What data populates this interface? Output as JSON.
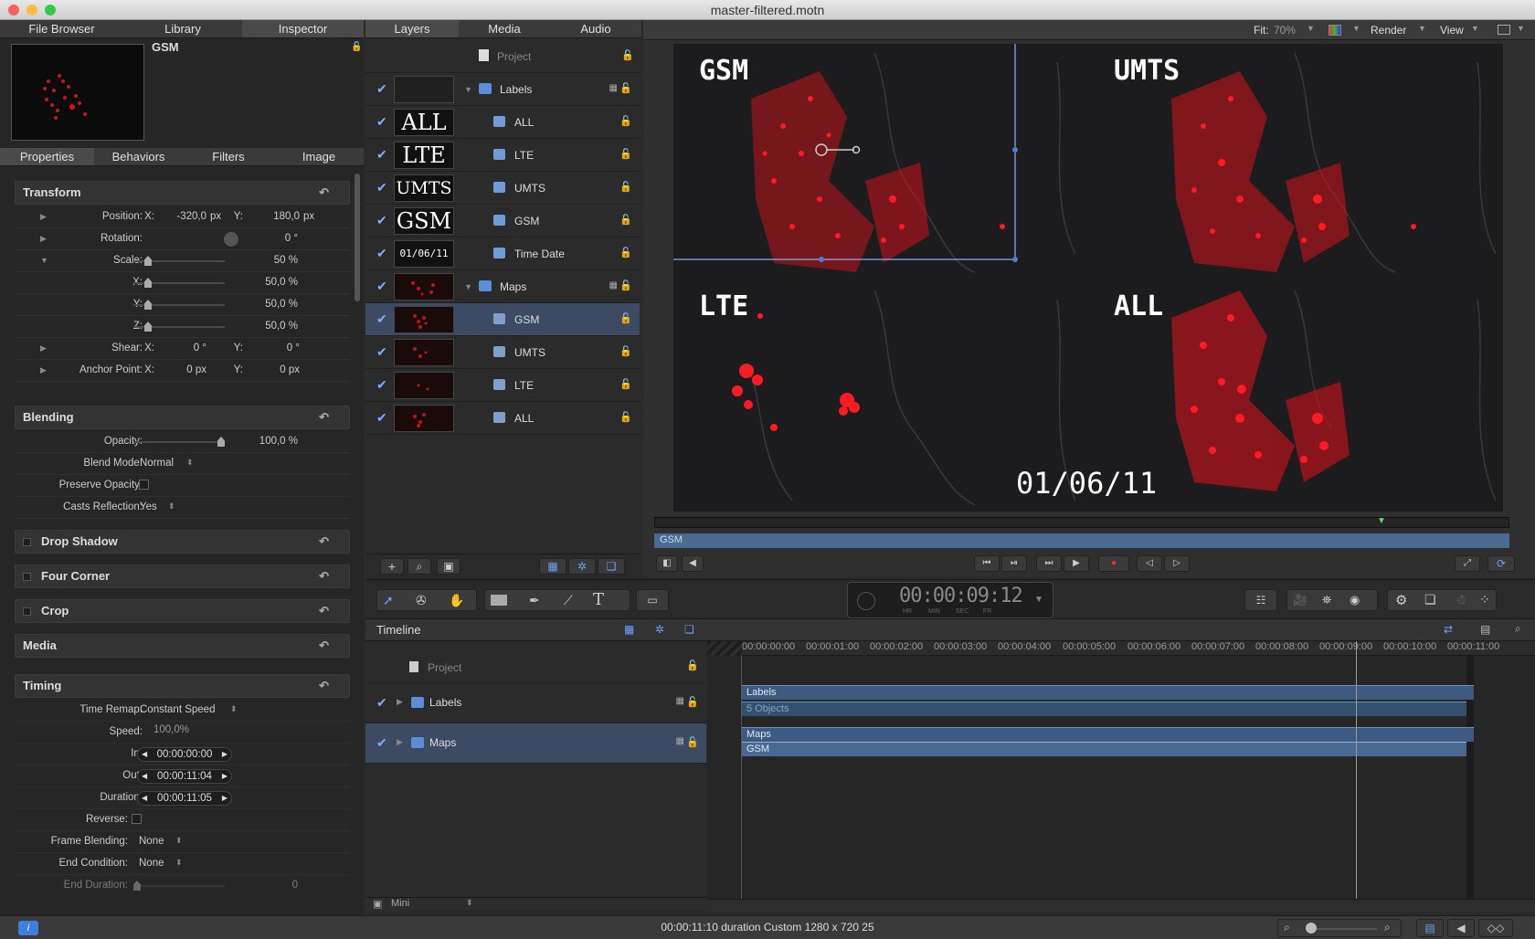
{
  "window": {
    "title": "master-filtered.motn"
  },
  "left_tabs": [
    "File Browser",
    "Library",
    "Inspector"
  ],
  "inspector": {
    "object_name": "GSM",
    "subtabs": [
      "Properties",
      "Behaviors",
      "Filters",
      "Image"
    ],
    "transform": {
      "title": "Transform",
      "position_label": "Position:",
      "position_x": "-320,0",
      "position_y": "180,0",
      "unit_px": "px",
      "rotation_label": "Rotation:",
      "rotation_value": "0 °",
      "scale_label": "Scale:",
      "scale_value": "50 %",
      "x_label": "X:",
      "x_value": "50,0 %",
      "y_label": "Y:",
      "y_value": "50,0 %",
      "z_label": "Z:",
      "z_value": "50,0 %",
      "shear_label": "Shear:",
      "shear_x": "0 °",
      "shear_y": "0 °",
      "anchor_label": "Anchor Point:",
      "anchor_x": "0 px",
      "anchor_y": "0 px",
      "xl": "X:",
      "yl": "Y:"
    },
    "blending": {
      "title": "Blending",
      "opacity_label": "Opacity:",
      "opacity_value": "100,0 %",
      "blend_mode_label": "Blend Mode:",
      "blend_mode_value": "Normal",
      "preserve_label": "Preserve Opacity:",
      "casts_label": "Casts Reflection:",
      "casts_value": "Yes"
    },
    "sections": [
      "Drop Shadow",
      "Four Corner",
      "Crop",
      "Media"
    ],
    "timing": {
      "title": "Timing",
      "remap_label": "Time Remap:",
      "remap_value": "Constant Speed",
      "speed_label": "Speed:",
      "speed_value": "100,0%",
      "in_label": "In:",
      "in_value": "00:00:00:00",
      "out_label": "Out:",
      "out_value": "00:00:11:04",
      "duration_label": "Duration:",
      "duration_value": "00:00:11:05",
      "reverse_label": "Reverse:",
      "frame_blending_label": "Frame Blending:",
      "frame_blending_value": "None",
      "end_condition_label": "End Condition:",
      "end_condition_value": "None",
      "end_duration_label": "End Duration:",
      "end_duration_value": "0"
    }
  },
  "layers_tabs": [
    "Layers",
    "Media",
    "Audio"
  ],
  "layers": {
    "project": "Project",
    "rows": [
      {
        "name": "Labels",
        "thumb": ""
      },
      {
        "name": "ALL",
        "thumb": "ALL"
      },
      {
        "name": "LTE",
        "thumb": "LTE"
      },
      {
        "name": "UMTS",
        "thumb": "UMTS"
      },
      {
        "name": "GSM",
        "thumb": "GSM"
      },
      {
        "name": "Time Date",
        "thumb": "01/06/11"
      },
      {
        "name": "Maps",
        "thumb": ""
      },
      {
        "name": "GSM",
        "thumb": ""
      },
      {
        "name": "UMTS",
        "thumb": ""
      },
      {
        "name": "LTE",
        "thumb": ""
      },
      {
        "name": "ALL",
        "thumb": ""
      }
    ]
  },
  "viewer_toolbar": {
    "fit_label": "Fit:",
    "fit_value": "70%",
    "render": "Render",
    "view": "View"
  },
  "canvas": {
    "labels": [
      "GSM",
      "UMTS",
      "LTE",
      "ALL"
    ],
    "date": "01/06/11"
  },
  "mini_timeline": {
    "clip": "GSM"
  },
  "timecode": {
    "value": "00:00:09:12",
    "units": [
      "HR",
      "MIN",
      "SEC",
      "FR"
    ]
  },
  "timeline": {
    "title": "Timeline",
    "project": "Project",
    "tracks": [
      "Labels",
      "Maps"
    ],
    "ruler": [
      "00:00:00:00",
      "00:00:01:00",
      "00:00:02:00",
      "00:00:03:00",
      "00:00:04:00",
      "00:00:05:00",
      "00:00:06:00",
      "00:00:07:00",
      "00:00:08:00",
      "00:00:09:00",
      "00:00:10:00",
      "00:00:11:00"
    ],
    "bars": {
      "labels": "Labels",
      "labels_sub": "5 Objects",
      "maps": "Maps",
      "maps_sub": "GSM"
    },
    "mini": "Mini"
  },
  "status": {
    "text": "00:00:11:10 duration Custom 1280 x 720 25"
  },
  "colors": {
    "accent": "#4a7fd4",
    "map_red": "#e0141e",
    "selection": "#3c4a63"
  }
}
